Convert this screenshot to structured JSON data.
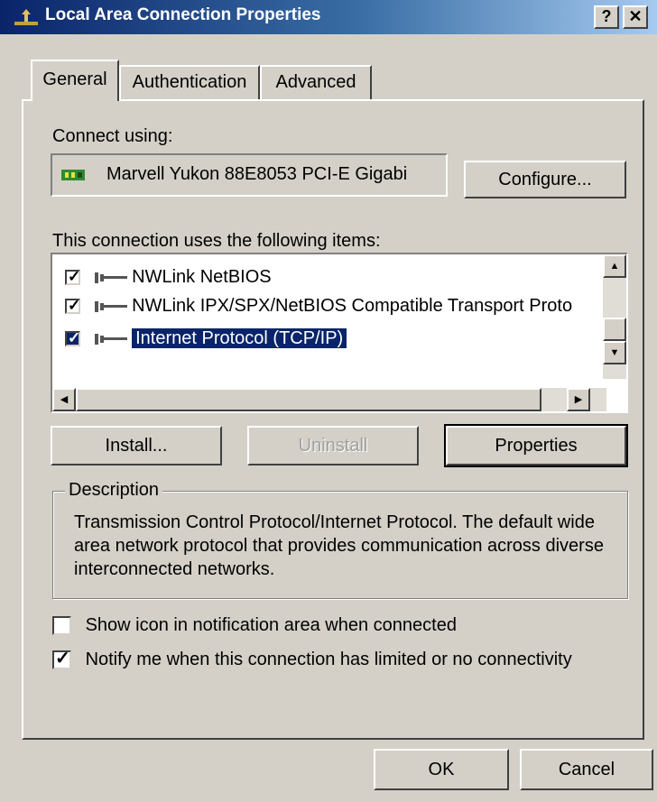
{
  "window": {
    "title": "Local Area Connection Properties",
    "help_label": "?",
    "close_label": "✕"
  },
  "tabs": [
    "General",
    "Authentication",
    "Advanced"
  ],
  "connect_using_label": "Connect using:",
  "adapter_name": "Marvell Yukon 88E8053 PCI-E Gigabi",
  "configure_label": "Configure...",
  "items_label": "This connection uses the following items:",
  "components": [
    {
      "label": "NWLink NetBIOS",
      "checked": true
    },
    {
      "label": "NWLink IPX/SPX/NetBIOS Compatible Transport Proto",
      "checked": true
    },
    {
      "label": "Internet Protocol (TCP/IP)",
      "checked": true,
      "selected": true
    }
  ],
  "buttons": {
    "install": "Install...",
    "uninstall": "Uninstall",
    "properties": "Properties"
  },
  "description": {
    "legend": "Description",
    "text": "Transmission Control Protocol/Internet Protocol. The default wide area network protocol that provides communication across diverse interconnected networks."
  },
  "options": [
    {
      "label": "Show icon in notification area when connected",
      "checked": false
    },
    {
      "label": "Notify me when this connection has limited or no connectivity",
      "checked": true
    }
  ],
  "dialog_buttons": {
    "ok": "OK",
    "cancel": "Cancel"
  },
  "icons": {
    "title": "network-connection-icon",
    "adapter": "network-card-icon",
    "protocol": "network-protocol-icon"
  }
}
